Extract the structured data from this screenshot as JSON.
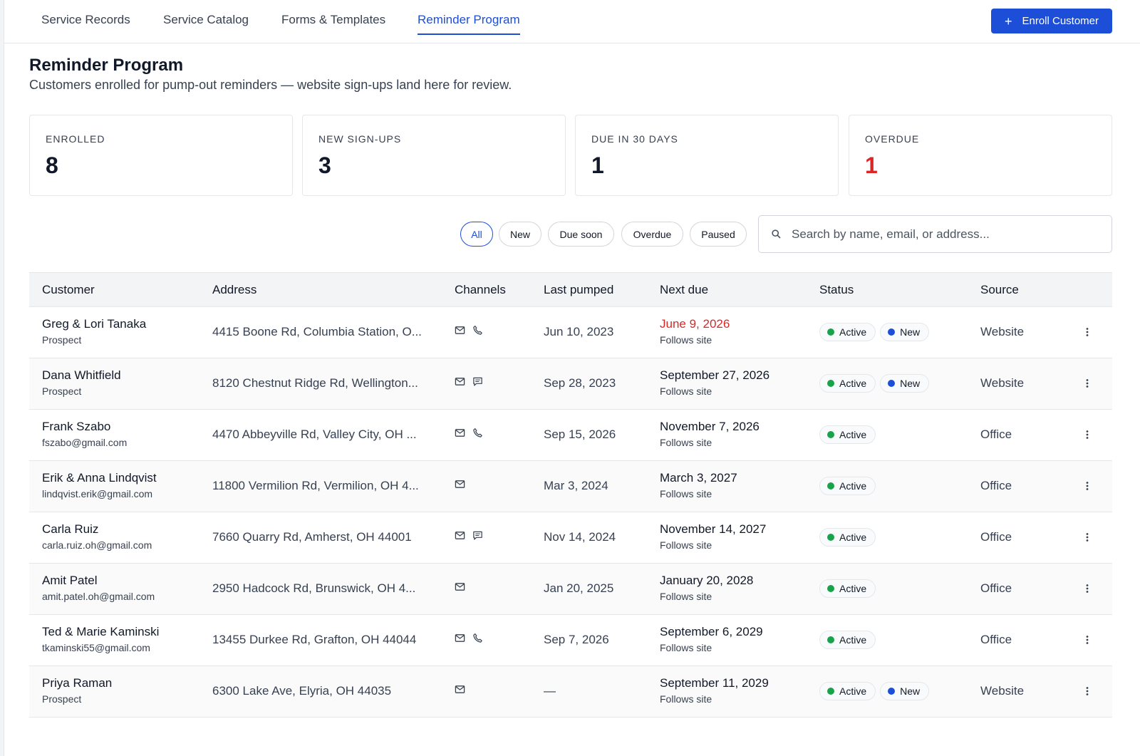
{
  "nav": {
    "tabs": [
      {
        "label": "Service Records"
      },
      {
        "label": "Service Catalog"
      },
      {
        "label": "Forms & Templates"
      },
      {
        "label": "Reminder Program"
      }
    ],
    "active_tab": "Reminder Program",
    "enroll_label": "Enroll Customer"
  },
  "header": {
    "title": "Reminder Program",
    "subtitle": "Customers enrolled for pump-out reminders — website sign-ups land here for review."
  },
  "stats": [
    {
      "label": "ENROLLED",
      "value": "8"
    },
    {
      "label": "NEW SIGN-UPS",
      "value": "3"
    },
    {
      "label": "DUE IN 30 DAYS",
      "value": "1"
    },
    {
      "label": "OVERDUE",
      "value": "1",
      "color": "#dc2626"
    }
  ],
  "filters": {
    "chips": [
      {
        "label": "All"
      },
      {
        "label": "New"
      },
      {
        "label": "Due soon"
      },
      {
        "label": "Overdue"
      },
      {
        "label": "Paused"
      }
    ],
    "active": "All",
    "search_placeholder": "Search by name, email, or address..."
  },
  "table": {
    "columns": [
      "Customer",
      "Address",
      "Channels",
      "Last pumped",
      "Next due",
      "Status",
      "Source"
    ],
    "rows": [
      {
        "name": "Greg & Lori Tanaka",
        "sub": "Prospect",
        "address": "4415 Boone Rd, Columbia Station, O...",
        "channels": [
          "mail-icon",
          "phone-icon"
        ],
        "last_pumped": "Jun 10, 2023",
        "next_due": "June 9, 2026",
        "overdue": true,
        "next_note": "Follows site",
        "statuses": [
          "Active",
          "New"
        ],
        "source": "Website"
      },
      {
        "name": "Dana Whitfield",
        "sub": "Prospect",
        "address": "8120 Chestnut Ridge Rd, Wellington...",
        "channels": [
          "mail-icon",
          "sms-icon"
        ],
        "last_pumped": "Sep 28, 2023",
        "next_due": "September 27, 2026",
        "next_note": "Follows site",
        "statuses": [
          "Active",
          "New"
        ],
        "source": "Website"
      },
      {
        "name": "Frank Szabo",
        "sub": "fszabo@gmail.com",
        "address": "4470 Abbeyville Rd, Valley City, OH ...",
        "channels": [
          "mail-icon",
          "phone-icon"
        ],
        "last_pumped": "Sep 15, 2026",
        "next_due": "November 7, 2026",
        "next_note": "Follows site",
        "statuses": [
          "Active"
        ],
        "source": "Office"
      },
      {
        "name": "Erik & Anna Lindqvist",
        "sub": "lindqvist.erik@gmail.com",
        "address": "11800 Vermilion Rd, Vermilion, OH 4...",
        "channels": [
          "mail-icon"
        ],
        "last_pumped": "Mar 3, 2024",
        "next_due": "March 3, 2027",
        "next_note": "Follows site",
        "statuses": [
          "Active"
        ],
        "source": "Office"
      },
      {
        "name": "Carla Ruiz",
        "sub": "carla.ruiz.oh@gmail.com",
        "address": "7660 Quarry Rd, Amherst, OH 44001",
        "channels": [
          "mail-icon",
          "sms-icon"
        ],
        "last_pumped": "Nov 14, 2024",
        "next_due": "November 14, 2027",
        "next_note": "Follows site",
        "statuses": [
          "Active"
        ],
        "source": "Office"
      },
      {
        "name": "Amit Patel",
        "sub": "amit.patel.oh@gmail.com",
        "address": "2950 Hadcock Rd, Brunswick, OH 4...",
        "channels": [
          "mail-icon"
        ],
        "last_pumped": "Jan 20, 2025",
        "next_due": "January 20, 2028",
        "next_note": "Follows site",
        "statuses": [
          "Active"
        ],
        "source": "Office"
      },
      {
        "name": "Ted & Marie Kaminski",
        "sub": "tkaminski55@gmail.com",
        "address": "13455 Durkee Rd, Grafton, OH 44044",
        "channels": [
          "mail-icon",
          "phone-icon"
        ],
        "last_pumped": "Sep 7, 2026",
        "next_due": "September 6, 2029",
        "next_note": "Follows site",
        "statuses": [
          "Active"
        ],
        "source": "Office"
      },
      {
        "name": "Priya Raman",
        "sub": "Prospect",
        "address": "6300 Lake Ave, Elyria, OH 44035",
        "channels": [
          "mail-icon"
        ],
        "last_pumped": "—",
        "next_due": "September 11, 2029",
        "next_note": "Follows site",
        "statuses": [
          "Active",
          "New"
        ],
        "source": "Website"
      }
    ]
  },
  "colors": {
    "accent": "#1d4ed8",
    "overdue": "#dc2626",
    "active_dot": "#16a34a",
    "new_dot": "#1d4ed8"
  }
}
